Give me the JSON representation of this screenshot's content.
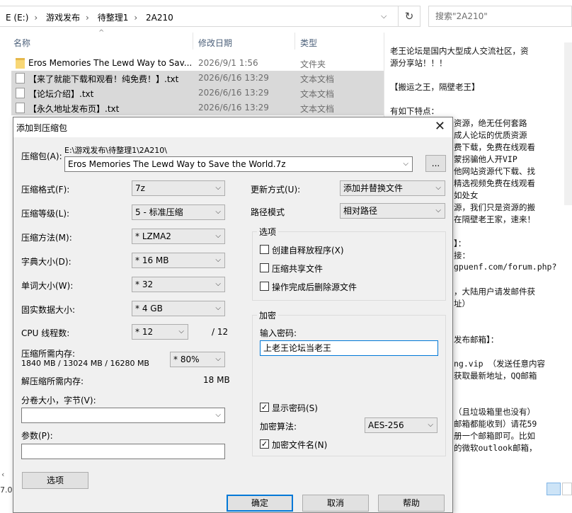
{
  "explorer": {
    "breadcrumbs": [
      "E (E:)",
      "游戏发布",
      "待整理1",
      "2A210"
    ],
    "search_placeholder": "搜索\"2A210\"",
    "columns": {
      "name": "名称",
      "date": "修改日期",
      "type": "类型"
    },
    "files": [
      {
        "name": "Eros Memories The Lewd Way to Sav...",
        "date": "2026/9/1 1:56",
        "type": "文件夹",
        "kind": "folder",
        "selected": false
      },
      {
        "name": "【来了就能下载和观看！纯免费！】.txt",
        "date": "2026/6/16 13:29",
        "type": "文本文档",
        "kind": "txt",
        "selected": true
      },
      {
        "name": "【论坛介绍】.txt",
        "date": "2026/6/16 13:29",
        "type": "文本文档",
        "kind": "txt",
        "selected": true
      },
      {
        "name": "【永久地址发布页】.txt",
        "date": "2026/6/16 13:29",
        "type": "文本文档",
        "kind": "txt",
        "selected": true
      }
    ],
    "status_left": "7.0"
  },
  "preview": {
    "lines": [
      "老王论坛是国内大型成人交流社区，资",
      "源分享站！！！",
      "",
      "【搬运之王，隔壁老王】",
      "",
      "有如下特点：",
      "资源，绝无任何套路",
      "成人论坛的优质资源",
      "费下载，免费在线观看",
      "蒙拐骗他人开VIP",
      "他网站资源代下载、找",
      "精选视频免费在线观看",
      "如处女",
      "源，我们只是资源的搬",
      "在隔壁老王家，速来！",
      "",
      "】：",
      "接：",
      "gpuenf.com/forum.php?",
      "",
      "，大陆用户请发邮件获",
      "址）",
      "",
      "",
      "发布邮箱】：",
      "",
      "ng.vip  （发送任意内容",
      "获取最新地址，QQ邮箱",
      "",
      "",
      "（且垃圾箱里也没有）",
      "邮箱都能收到）请花59",
      "册一个邮箱即可。比如",
      "的微软outlook邮箱，"
    ]
  },
  "dialog": {
    "title": "添加到压缩包",
    "archive_label": "压缩包(A):",
    "archive_path": "E:\\游戏发布\\待整理1\\2A210\\",
    "archive_name": "Eros Memories The Lewd Way to Save the World.7z",
    "browse_label": "...",
    "format_label": "压缩格式(F):",
    "format_value": "7z",
    "level_label": "压缩等级(L):",
    "level_value": "5 - 标准压缩",
    "method_label": "压缩方法(M):",
    "method_value": "* LZMA2",
    "dict_label": "字典大小(D):",
    "dict_value": "* 16 MB",
    "word_label": "单词大小(W):",
    "word_value": "* 32",
    "solid_label": "固实数据大小:",
    "solid_value": "* 4 GB",
    "threads_label": "CPU 线程数:",
    "threads_value": "* 12",
    "threads_total": "/ 12",
    "mem_label": "压缩所需内存:",
    "mem_value": "1840 MB / 13024 MB / 16280 MB",
    "mem_pct": "* 80%",
    "decomp_label": "解压缩所需内存:",
    "decomp_value": "18 MB",
    "split_label": "分卷大小，字节(V):",
    "split_value": "",
    "params_label": "参数(P):",
    "params_value": "",
    "options_button": "选项",
    "update_label": "更新方式(U):",
    "update_value": "添加并替换文件",
    "pathmode_label": "路径模式",
    "pathmode_value": "相对路径",
    "options_group": "选项",
    "opt_sfx": "创建自释放程序(X)",
    "opt_shared": "压缩共享文件",
    "opt_delete": "操作完成后删除源文件",
    "enc_group": "加密",
    "password_label": "输入密码:",
    "password_value": "上老王论坛当老王",
    "show_password": "显示密码(S)",
    "enc_method_label": "加密算法:",
    "enc_method_value": "AES-256",
    "enc_names": "加密文件名(N)",
    "ok": "确定",
    "cancel": "取消",
    "help": "帮助"
  }
}
